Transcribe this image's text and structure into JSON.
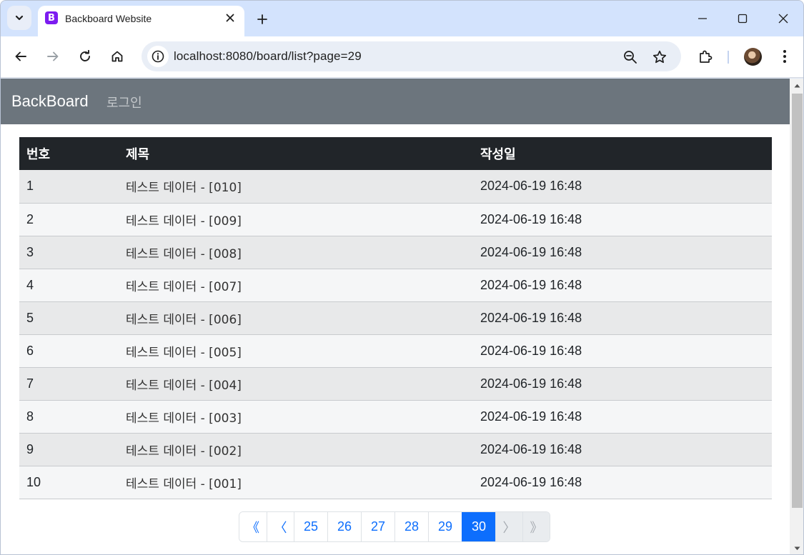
{
  "browser": {
    "tab_title": "Backboard Website",
    "favicon_letter": "B",
    "url": "localhost:8080/board/list?page=29"
  },
  "navbar": {
    "brand": "BackBoard",
    "login": "로그인"
  },
  "table": {
    "headers": [
      "번호",
      "제목",
      "작성일"
    ],
    "rows": [
      {
        "num": "1",
        "title": "테스트 데이터 - [010]",
        "date": "2024-06-19 16:48"
      },
      {
        "num": "2",
        "title": "테스트 데이터 - [009]",
        "date": "2024-06-19 16:48"
      },
      {
        "num": "3",
        "title": "테스트 데이터 - [008]",
        "date": "2024-06-19 16:48"
      },
      {
        "num": "4",
        "title": "테스트 데이터 - [007]",
        "date": "2024-06-19 16:48"
      },
      {
        "num": "5",
        "title": "테스트 데이터 - [006]",
        "date": "2024-06-19 16:48"
      },
      {
        "num": "6",
        "title": "테스트 데이터 - [005]",
        "date": "2024-06-19 16:48"
      },
      {
        "num": "7",
        "title": "테스트 데이터 - [004]",
        "date": "2024-06-19 16:48"
      },
      {
        "num": "8",
        "title": "테스트 데이터 - [003]",
        "date": "2024-06-19 16:48"
      },
      {
        "num": "9",
        "title": "테스트 데이터 - [002]",
        "date": "2024-06-19 16:48"
      },
      {
        "num": "10",
        "title": "테스트 데이터 - [001]",
        "date": "2024-06-19 16:48"
      }
    ]
  },
  "pagination": {
    "first": "《",
    "prev": "〈",
    "pages": [
      "25",
      "26",
      "27",
      "28",
      "29",
      "30"
    ],
    "active": "30",
    "next": "〉",
    "last": "》"
  },
  "colors": {
    "navbar_bg": "#6c757d",
    "table_header_bg": "#212529",
    "accent": "#0d6efd"
  }
}
